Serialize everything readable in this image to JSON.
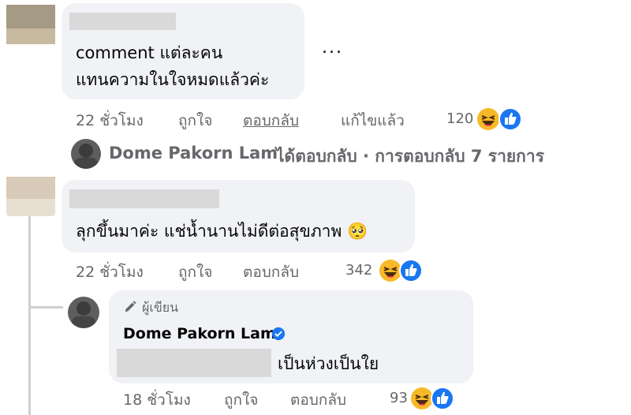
{
  "comments": [
    {
      "text_line1": "comment แต่ละคน",
      "text_line2": "แทนความในใจหมดแล้วค่ะ",
      "more": "...",
      "time": "22 ชั่วโมง",
      "like": "ถูกใจ",
      "reply": "ตอบกลับ",
      "edited": "แก้ไขแล้ว",
      "reaction_count": "120",
      "reactions": [
        "haha-icon",
        "like-icon"
      ]
    },
    {
      "text": "ลุกขึ้นมาค่ะ แช่น้ำนานไม่ดีต่อสุขภาพ 🥺",
      "time": "22 ชั่วโมง",
      "like": "ถูกใจ",
      "reply": "ตอบกลับ",
      "reaction_count": "342",
      "reactions": [
        "haha-icon",
        "like-icon"
      ]
    }
  ],
  "reply_summary": {
    "name": "Dome Pakorn Lam",
    "text": "ได้ตอบกลับ · การตอบกลับ 7 รายการ"
  },
  "author_reply": {
    "badge": "ผู้เขียน",
    "name": "Dome Pakorn Lam",
    "verified": true,
    "text": "เป็นห่วงเป็นใย",
    "time": "18 ชั่วโมง",
    "like": "ถูกใจ",
    "reply": "ตอบกลับ",
    "reaction_count": "93",
    "reactions": [
      "haha-icon",
      "like-icon"
    ]
  },
  "colors": {
    "bubble": "#f0f2f5",
    "like_blue": "#1877f2",
    "haha_yellow": "#f7b928",
    "secondary_text": "#65676b"
  }
}
